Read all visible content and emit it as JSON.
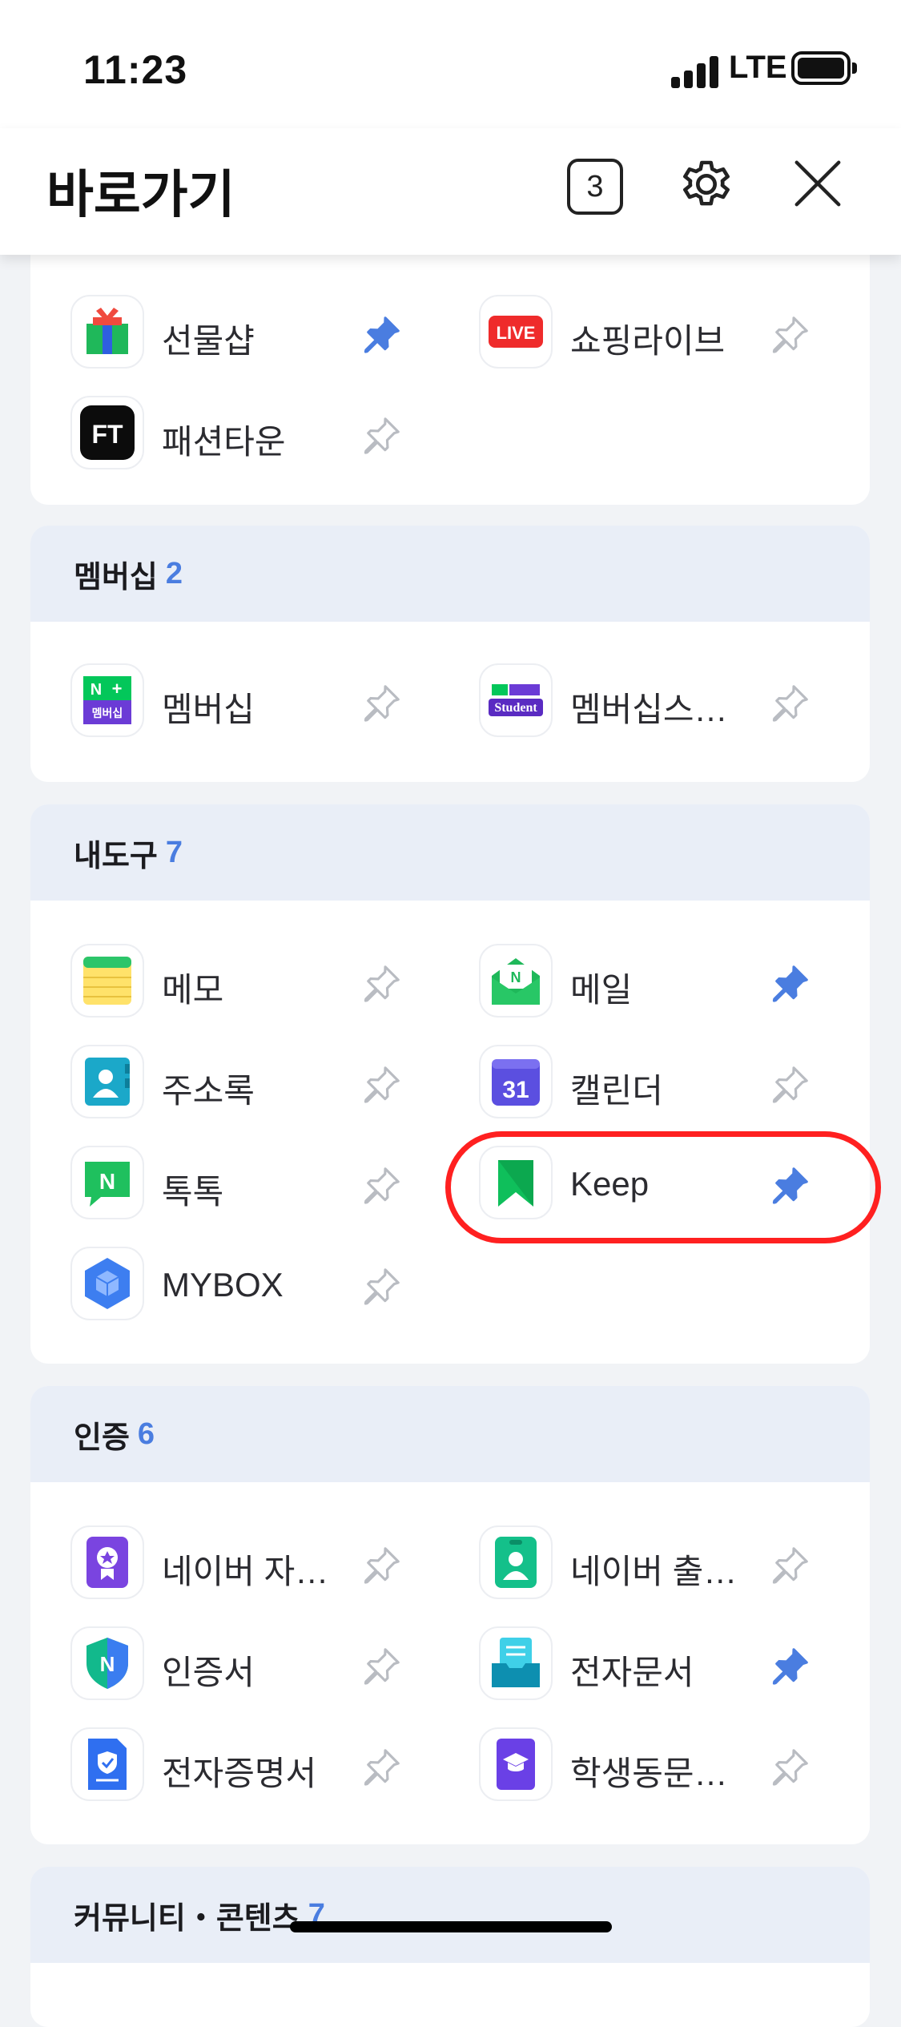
{
  "status_bar": {
    "time": "11:23",
    "network": "LTE"
  },
  "header": {
    "title": "바로가기",
    "tab_count": "3"
  },
  "sections": {
    "shopping": {
      "items": [
        {
          "label": "선물샵",
          "pinned": true,
          "icon": "gift-icon"
        },
        {
          "label": "쇼핑라이브",
          "pinned": false,
          "icon": "live-icon",
          "icon_text": "LIVE"
        },
        {
          "label": "패션타운",
          "pinned": false,
          "icon": "fashion-town-icon",
          "icon_text": "FT"
        }
      ]
    },
    "membership": {
      "name": "멤버십",
      "count": "2",
      "items": [
        {
          "label": "멤버십",
          "pinned": false,
          "icon": "membership-icon",
          "icon_text": "멤버십"
        },
        {
          "label": "멤버십스…",
          "pinned": false,
          "icon": "membership-student-icon",
          "icon_text": "Student"
        }
      ]
    },
    "tools": {
      "name": "내도구",
      "count": "7",
      "items": [
        {
          "label": "메모",
          "pinned": false,
          "icon": "memo-icon"
        },
        {
          "label": "메일",
          "pinned": true,
          "icon": "mail-icon"
        },
        {
          "label": "주소록",
          "pinned": false,
          "icon": "contacts-icon"
        },
        {
          "label": "캘린더",
          "pinned": false,
          "icon": "calendar-icon",
          "icon_text": "31"
        },
        {
          "label": "톡톡",
          "pinned": false,
          "icon": "talktalk-icon"
        },
        {
          "label": "Keep",
          "pinned": true,
          "icon": "keep-icon"
        },
        {
          "label": "MYBOX",
          "pinned": false,
          "icon": "mybox-icon"
        }
      ]
    },
    "auth": {
      "name": "인증",
      "count": "6",
      "items": [
        {
          "label": "네이버 자…",
          "pinned": false,
          "icon": "certificate-badge-icon"
        },
        {
          "label": "네이버 출…",
          "pinned": false,
          "icon": "id-card-icon"
        },
        {
          "label": "인증서",
          "pinned": false,
          "icon": "shield-icon"
        },
        {
          "label": "전자문서",
          "pinned": true,
          "icon": "edocument-icon"
        },
        {
          "label": "전자증명서",
          "pinned": false,
          "icon": "ecertificate-icon"
        },
        {
          "label": "학생동문…",
          "pinned": false,
          "icon": "student-alumni-icon"
        }
      ]
    },
    "community": {
      "name": "커뮤니티・콘텐츠",
      "count": "7"
    }
  },
  "colors": {
    "accent": "#4a7de0",
    "naver_green": "#03c75a",
    "highlight": "#ff2020"
  }
}
